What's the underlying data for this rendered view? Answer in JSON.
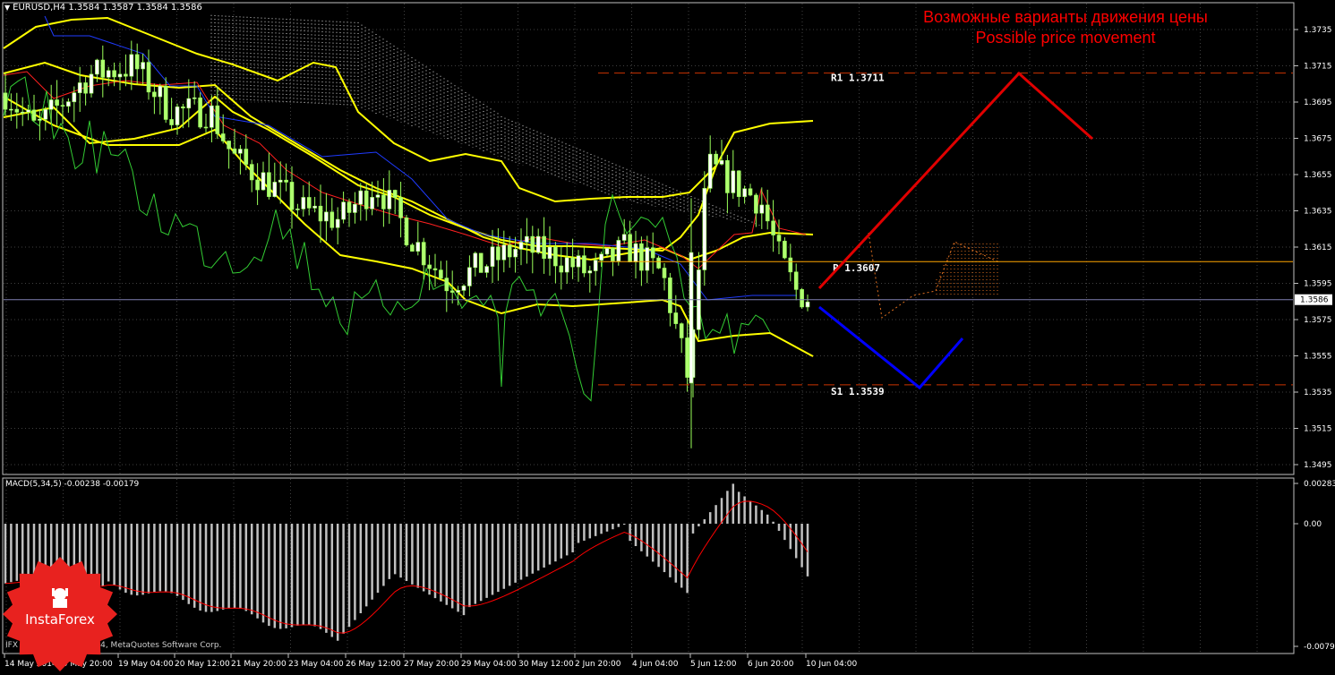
{
  "header": {
    "symbol_info": "EURUSD,H4  1.3584 1.3587 1.3584 1.3586",
    "dropdown_icon": "triangle-down-icon"
  },
  "forecast": {
    "title_ru": "Возможные варианты движения цены",
    "title_en": "Possible price movement",
    "up_color": "#e00000",
    "down_color": "#0000ff"
  },
  "levels": {
    "r1": {
      "label": "R1  1.3711",
      "value": 1.3711,
      "color": "#cc3300"
    },
    "p": {
      "label": "P  1.3607",
      "value": 1.3607,
      "color": "#ffa500"
    },
    "s1": {
      "label": "S1  1.3539",
      "value": 1.3539,
      "color": "#cc3300"
    },
    "current": {
      "label": "1.3586",
      "value": 1.3586
    }
  },
  "price_axis": {
    "labels": [
      "1.3735",
      "1.3715",
      "1.3695",
      "1.3675",
      "1.3655",
      "1.3635",
      "1.3615",
      "1.3595",
      "1.3575",
      "1.3555",
      "1.3535",
      "1.3515",
      "1.3495"
    ],
    "range": [
      1.3485,
      1.3745
    ]
  },
  "macd": {
    "header": "MACD(5,34,5) -0.00238 -0.00179",
    "axis_labels": [
      "0.00283",
      "0.00",
      "-0.00791"
    ],
    "histogram_color": "#c0c0c0",
    "signal_color": "#ff0000",
    "range": [
      -0.00791,
      0.00283
    ]
  },
  "time_axis": {
    "labels": [
      "14 May 2014",
      "15 May 20:00",
      "19 May 04:00",
      "20 May 12:00",
      "21 May 20:00",
      "23 May 04:00",
      "26 May 12:00",
      "27 May 20:00",
      "29 May 04:00",
      "30 May 12:00",
      "2 Jun 20:00",
      "4 Jun 04:00",
      "5 Jun 12:00",
      "6 Jun 20:00",
      "10 Jun 04:00"
    ]
  },
  "footer": {
    "copyright": "IFX Trader, © 2001-2014, MetaQuotes Software Corp."
  },
  "logo": {
    "brand": "InstaForex",
    "color": "#e8221f"
  },
  "colors": {
    "background": "#000000",
    "grid": "#404040",
    "candle_bull": "#ffffff",
    "candle_bear": "#b0ff70",
    "wick": "#9aff5a",
    "bollinger": "#ffff00",
    "tenkan": "#ff2020",
    "kijun": "#1f3bff",
    "chikou": "#33cc33",
    "cloud": "#d8d8d8",
    "cloud_alt": "#e07020"
  }
}
